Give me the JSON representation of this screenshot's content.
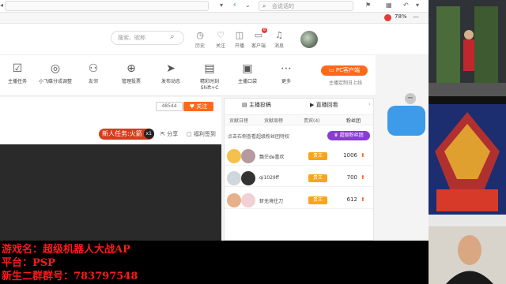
{
  "browser": {
    "search_placeholder": "会说话的",
    "battery": "78%"
  },
  "header": {
    "search_placeholder": "搜索、昵称",
    "tools": [
      {
        "label": "历史"
      },
      {
        "label": "关注"
      },
      {
        "label": "开播"
      },
      {
        "label": "客户端",
        "badge": "8"
      },
      {
        "label": "消息"
      }
    ]
  },
  "nav": {
    "items": [
      {
        "label": "主播任务"
      },
      {
        "label": "小飞碟分成调整"
      },
      {
        "label": "友邻"
      },
      {
        "label": "管理投票"
      },
      {
        "label": "发布动态"
      },
      {
        "label": "精彩时刻 Shift+C"
      },
      {
        "label": "主播口袋"
      },
      {
        "label": "更多"
      }
    ],
    "pc_button": "PC客户端",
    "pc_tip": "主播定制日上线"
  },
  "room": {
    "fans": "48544",
    "follow": "关注",
    "task_label": "新人任务:火箭",
    "task_mult": "x1",
    "share": "分享",
    "sign": "福利签到"
  },
  "rank": {
    "tabs": [
      "主播投稿",
      "直播回看"
    ],
    "subtabs": [
      "贡献日榜",
      "贡献周榜",
      "贵宾(4)",
      "粉丝团"
    ],
    "vip_prompt": "点击右侧查看超级粉丝团特权",
    "vip_button": "超级粉丝团",
    "rows": [
      {
        "name": "飘茫de喜欢",
        "level": "贵王",
        "value": "1006"
      },
      {
        "name": "qi1029ff",
        "level": "贵王",
        "value": "700"
      },
      {
        "name": "斩无境往刀",
        "level": "贵王",
        "value": "612"
      }
    ]
  },
  "overlay": {
    "line1": "游戏名：超级机器人大战AP",
    "line2": "平台：PSP",
    "line3": "新生二群群号：783797548"
  },
  "colors": {
    "accent": "#ff6a1a",
    "overlay_text": "#ff1a1a"
  }
}
